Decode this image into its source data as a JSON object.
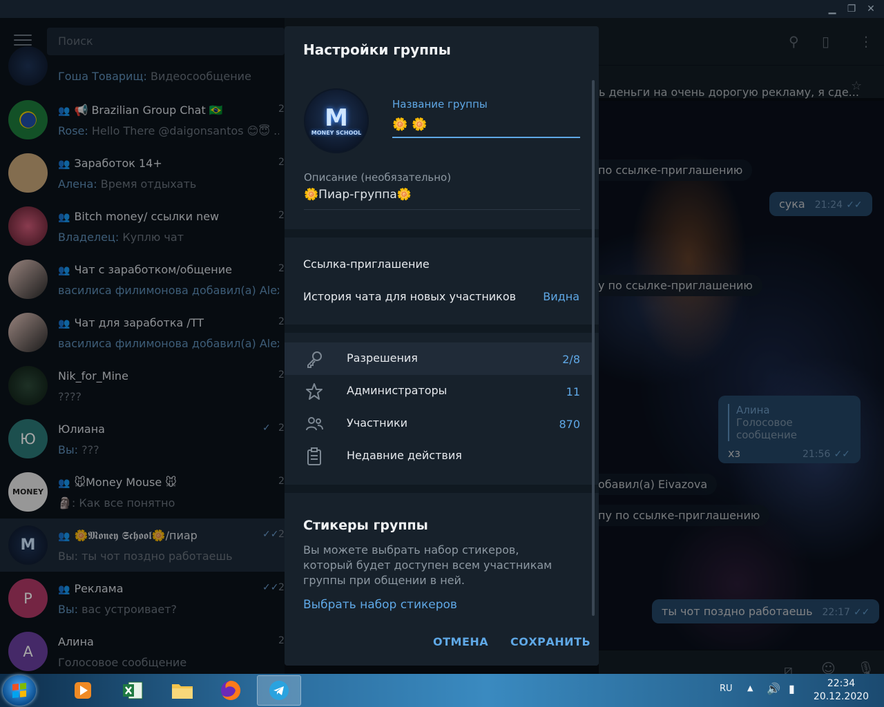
{
  "window": {
    "minimize": "▁",
    "restore": "❐",
    "close": "✕"
  },
  "sidebar": {
    "search_placeholder": "Поиск",
    "chats": [
      {
        "name": "",
        "sender": "Гоша Товарищ",
        "preview": "Видеосообщение",
        "time": ""
      },
      {
        "name": "📢 Brazilian Group Chat 🇧🇷",
        "sender": "Rose",
        "preview": "Hello There @daigonsantos 😊😇 ...",
        "time": "2"
      },
      {
        "name": "Заработок 14+",
        "sender": "Алена",
        "preview": "Время отдыхать",
        "time": "2"
      },
      {
        "name": "Bitch money/ ссылки new",
        "sender": "Владелец",
        "preview": "Куплю чат",
        "time": "2"
      },
      {
        "name": "Чат с заработком/общение",
        "sender": "",
        "preview": "василиса филимонова добавил(а) Alex ...",
        "time": "2"
      },
      {
        "name": "Чат для заработка /TT",
        "sender": "",
        "preview": "василиса филимонова добавил(а) Alex G...",
        "time": "2"
      },
      {
        "name": "Nik_for_Mine",
        "sender": "",
        "preview": "????",
        "time": "2"
      },
      {
        "name": "Юлиана",
        "sender": "Вы",
        "preview": "???",
        "time": "2",
        "avatar_letter": "Ю",
        "avatar_color": "#2c7a79"
      },
      {
        "name": "🐭Money Mouse 🐭",
        "sender": "",
        "preview": "🗿: Как все понятно",
        "time": "2"
      },
      {
        "name": "🌼𝕸𝖔𝖓𝖊𝖞 𝕾𝖈𝖍𝖔𝖔𝖑🌼/пиар",
        "sender": "Вы",
        "preview": "ты чот поздно работаешь",
        "time": "2"
      },
      {
        "name": "Реклама",
        "sender": "Вы",
        "preview": "вас устроивает?",
        "time": "2",
        "avatar_letter": "Р",
        "avatar_color": "#b23a68"
      },
      {
        "name": "Алина",
        "sender": "",
        "preview": "Голосовое сообщение",
        "time": "2",
        "avatar_letter": "А",
        "avatar_color": "#6a3fa0"
      }
    ]
  },
  "chat_area": {
    "pinned": "ь деньги на очень дорогую рекламу, я сде...",
    "service_1": "по ссылке-приглашению",
    "msg_1": {
      "text": "сука",
      "time": "21:24"
    },
    "service_2": "у по ссылке-приглашению",
    "reply_msg": {
      "reply_name": "Алина",
      "reply_text": "Голосовое сообщение",
      "text": "хз",
      "time": "21:56"
    },
    "service_3": "обавил(а) Eivazova",
    "service_4": "пу по ссылке-приглашению",
    "msg_2": {
      "text": "ты чот поздно работаешь",
      "time": "22:17"
    }
  },
  "dialog": {
    "title": "Настройки группы",
    "name_label": "Название группы",
    "name_value": "🌼                    🌼",
    "desc_label": "Описание (необязательно)",
    "desc_value": "🌼Пиар-группа🌼",
    "invite_link": "Ссылка-приглашение",
    "history_label": "История чата для новых участников",
    "history_value": "Видна",
    "rows": [
      {
        "label": "Разрешения",
        "value": "2/8",
        "icon": "key-icon"
      },
      {
        "label": "Администраторы",
        "value": "11",
        "icon": "star-icon"
      },
      {
        "label": "Участники",
        "value": "870",
        "icon": "users-icon"
      },
      {
        "label": "Недавние действия",
        "value": "",
        "icon": "clipboard-icon"
      }
    ],
    "stickers_title": "Стикеры группы",
    "stickers_desc": "Вы можете выбрать набор стикеров, который будет доступен всем участникам группы при общении в ней.",
    "stickers_link": "Выбрать набор стикеров",
    "cancel": "ОТМЕНА",
    "save": "СОХРАНИТЬ"
  },
  "taskbar": {
    "lang": "RU",
    "time": "22:34",
    "date": "20.12.2020"
  }
}
